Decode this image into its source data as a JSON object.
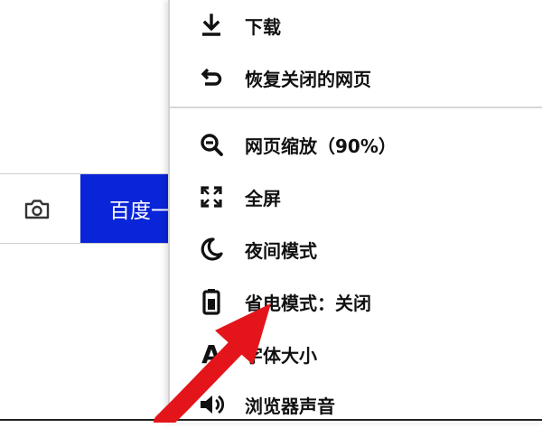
{
  "search": {
    "button_label": "百度一下"
  },
  "menu": {
    "items": [
      {
        "label": "下载",
        "icon": "download-icon"
      },
      {
        "label": "恢复关闭的网页",
        "icon": "undo-icon"
      },
      {
        "label": "网页缩放（90%）",
        "icon": "zoom-out-icon"
      },
      {
        "label": "全屏",
        "icon": "fullscreen-icon"
      },
      {
        "label": "夜间模式",
        "icon": "moon-icon"
      },
      {
        "label": "省电模式：关闭",
        "icon": "battery-icon"
      },
      {
        "label": "字体大小",
        "icon": "font-size-icon",
        "glyph": "A"
      },
      {
        "label": "浏览器声音",
        "icon": "speaker-icon"
      }
    ]
  },
  "colors": {
    "search_button": "#0a24d8",
    "annotation_arrow": "#e3151a"
  }
}
